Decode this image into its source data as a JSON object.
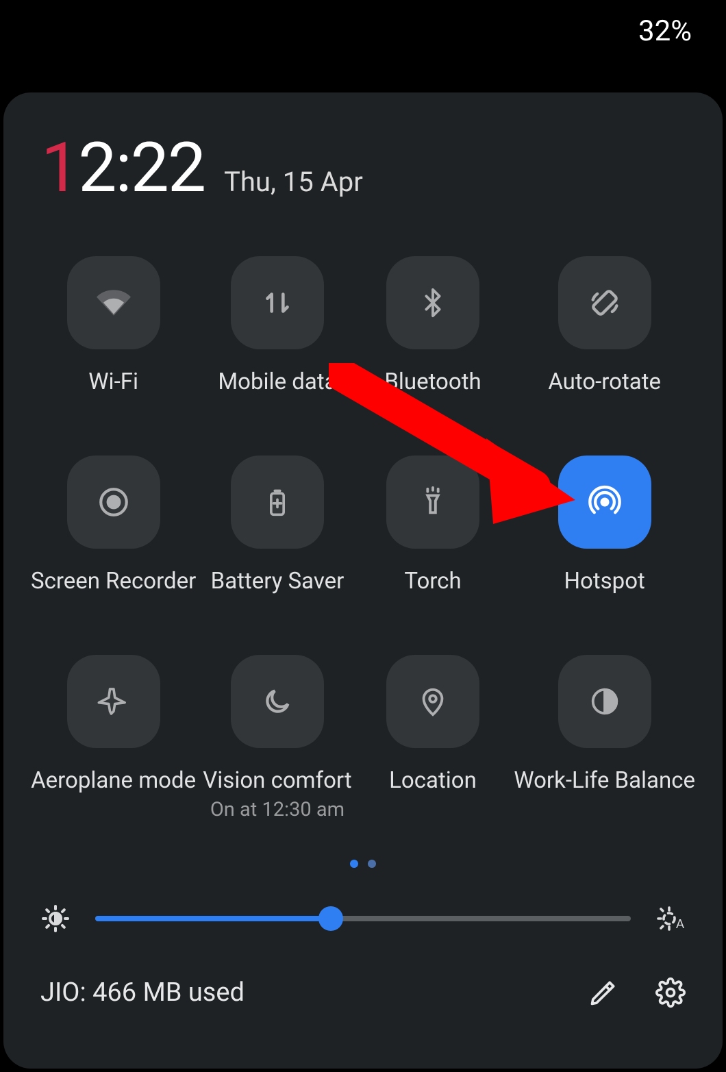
{
  "status": {
    "battery": "32%"
  },
  "clock": {
    "leading": "1",
    "rest": "2:22"
  },
  "date": "Thu, 15 Apr",
  "tiles": [
    {
      "label": "Wi-Fi",
      "active": false
    },
    {
      "label": "Mobile data",
      "active": false
    },
    {
      "label": "Bluetooth",
      "active": false
    },
    {
      "label": "Auto-rotate",
      "active": false
    },
    {
      "label": "Screen Recorder",
      "active": false
    },
    {
      "label": "Battery Saver",
      "active": false
    },
    {
      "label": "Torch",
      "active": false
    },
    {
      "label": "Hotspot",
      "active": true
    },
    {
      "label": "Aeroplane mode",
      "active": false
    },
    {
      "label": "Vision comfort",
      "sub": "On at 12:30 am",
      "active": false
    },
    {
      "label": "Location",
      "active": false
    },
    {
      "label": "Work-Life Balance",
      "active": false
    }
  ],
  "brightness": {
    "percent": 44
  },
  "footer": {
    "usage": "JIO: 466 MB used"
  }
}
